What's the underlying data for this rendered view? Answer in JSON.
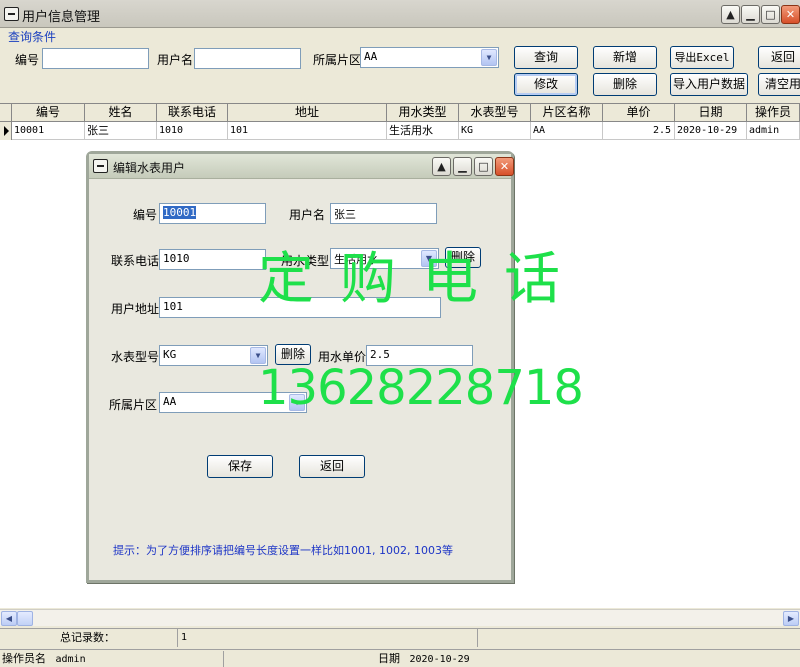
{
  "window": {
    "title": "用户信息管理"
  },
  "query": {
    "group_label": "查询条件",
    "id_label": "编号",
    "id_value": "",
    "username_label": "用户名",
    "username_value": "",
    "district_label": "所属片区",
    "district_value": "AA"
  },
  "toolbar": {
    "query": "查询",
    "add": "新增",
    "export_excel": "导出Excel",
    "back": "返回",
    "edit": "修改",
    "delete": "删除",
    "import_users": "导入用户数据",
    "clear": "清空用"
  },
  "grid": {
    "columns": [
      "编号",
      "姓名",
      "联系电话",
      "地址",
      "用水类型",
      "水表型号",
      "片区名称",
      "单价",
      "日期",
      "操作员"
    ],
    "rows": [
      [
        "10001",
        "张三",
        "1010",
        "101",
        "生活用水",
        "KG",
        "AA",
        "2.5",
        "2020-10-29",
        "admin"
      ]
    ]
  },
  "summary": {
    "total_label": "总记录数：",
    "total_value": "1"
  },
  "status": {
    "operator_label": "操作员名",
    "operator_value": "admin",
    "date_label": "日期",
    "date_value": "2020-10-29"
  },
  "dialog": {
    "title": "编辑水表用户",
    "id_label": "编号",
    "id_value": "10001",
    "username_label": "用户名",
    "username_value": "张三",
    "phone_label": "联系电话",
    "phone_value": "1010",
    "water_type_label": "用水类型",
    "water_type_value": "生活用水",
    "delete_label": "删除",
    "address_label": "用户地址",
    "address_value": "101",
    "meter_label": "水表型号",
    "meter_value": "KG",
    "price_label": "用水单价",
    "price_value": "2.5",
    "district_label": "所属片区",
    "district_value": "AA",
    "save_label": "保存",
    "back_label": "返回",
    "hint": "提示：为了方便排序请把编号长度设置一样比如1001, 1002, 1003等"
  },
  "watermark": {
    "line1": "定购电话",
    "line2": "13628228718"
  },
  "colors": {
    "accent_blue": "#1a3fbf",
    "watermark_green": "#1ee04a",
    "close_red": "#d7502a"
  },
  "icons": {
    "system_menu": "system-menu-icon",
    "minimize": "minimize-icon",
    "maximize": "maximize-icon",
    "close": "close-icon",
    "dropdown": "chevron-down-icon",
    "row_selector": "row-selector-icon"
  }
}
